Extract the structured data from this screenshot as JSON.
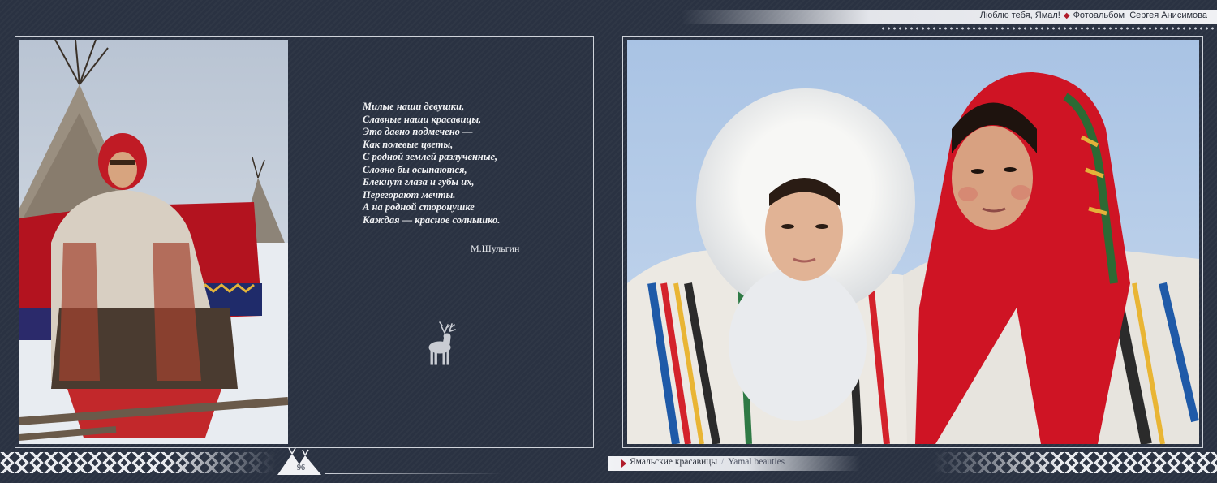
{
  "header": {
    "album_title": "Люблю тебя, Ямал!",
    "subtitle": "Фотоальбом  Сергея Анисимова"
  },
  "left_page": {
    "photo": "portrait of a Nenets woman in fur clothing sitting on a sledge in front of chums",
    "poem_lines": [
      "Милые наши девушки,",
      "Славные наши красавицы,",
      "Это давно подмечено —",
      "Как полевые цветы,",
      "С родной землей разлученные,",
      "Словно бы осыпаются,",
      "Блекнут глаза и губы их,",
      "Перегорают мечты.",
      "А на родной сторонушке",
      "Каждая — красное солнышко."
    ],
    "author": "М.Шульгин",
    "decoration": "reindeer-icon",
    "page_number": "96"
  },
  "right_page": {
    "photo": "two young Nenets women, one in white fur hood, one in red headscarf",
    "caption_ru": "Ямальские красавицы",
    "caption_separator": "/",
    "caption_en": "Yamal beauties"
  },
  "colors": {
    "background": "#2a3242",
    "accent_red": "#b01c2b",
    "frame": "#cfd3da"
  }
}
